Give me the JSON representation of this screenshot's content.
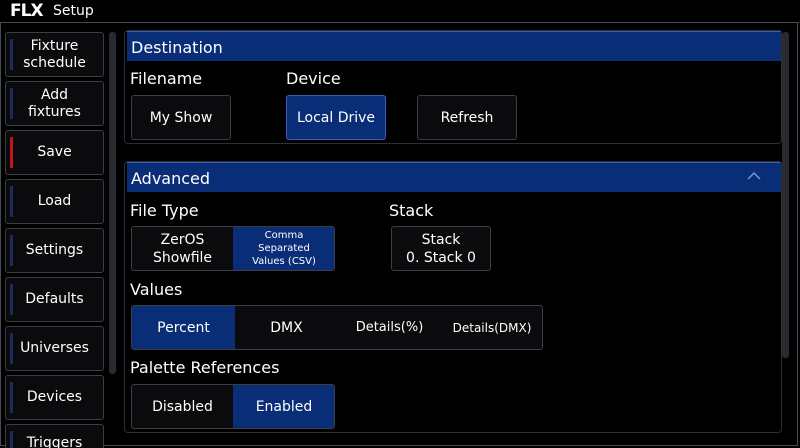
{
  "window": {
    "logo": "FLX",
    "title": "Setup"
  },
  "sidebar": {
    "items": [
      {
        "label": "Fixture schedule"
      },
      {
        "label": "Add fixtures"
      },
      {
        "label": "Save"
      },
      {
        "label": "Load"
      },
      {
        "label": "Settings"
      },
      {
        "label": "Defaults"
      },
      {
        "label": "Universes"
      },
      {
        "label": "Devices"
      },
      {
        "label": "Triggers"
      }
    ],
    "active": "Save"
  },
  "destination": {
    "header": "Destination",
    "filename_label": "Filename",
    "filename_value": "My Show",
    "device_label": "Device",
    "device_button": "Local Drive",
    "refresh_button": "Refresh"
  },
  "advanced": {
    "header": "Advanced",
    "file_type_label": "File Type",
    "file_type_options": [
      "ZerOS Showfile",
      "Comma Separated Values (CSV)"
    ],
    "file_type_selected": "Comma Separated Values (CSV)",
    "stack_label": "Stack",
    "stack_button_line1": "Stack",
    "stack_button_line2": "0. Stack 0",
    "values_label": "Values",
    "values_options": [
      "Percent",
      "DMX",
      "Details(%)",
      "Details(DMX)"
    ],
    "values_selected": "Percent",
    "palette_label": "Palette References",
    "palette_options": [
      "Disabled",
      "Enabled"
    ],
    "palette_selected": "Enabled"
  },
  "colors": {
    "accent": "#0a2d78",
    "active_marker": "#c21616",
    "background": "#000000"
  }
}
